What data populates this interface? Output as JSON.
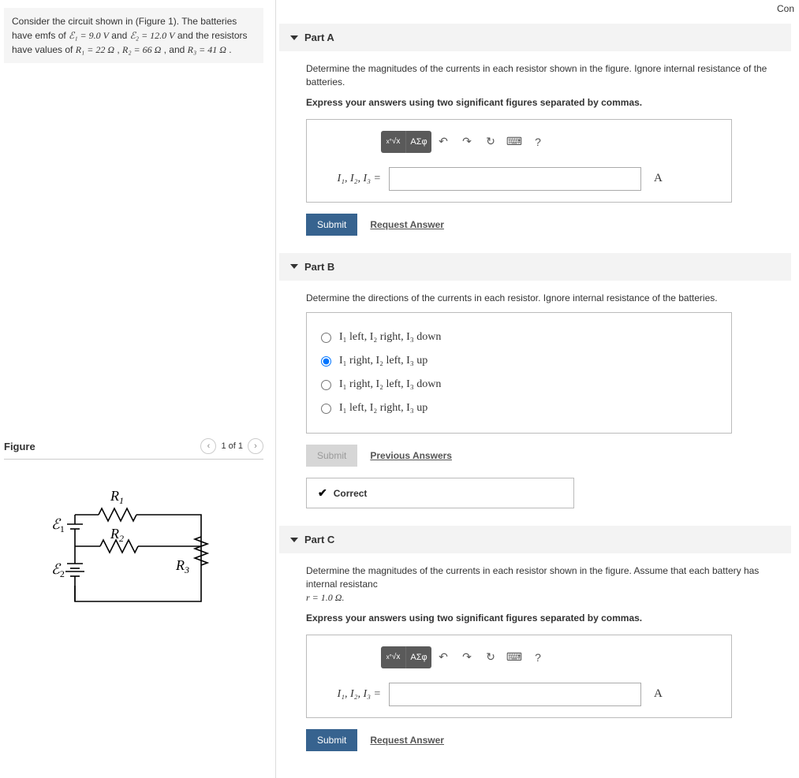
{
  "top_right": "Con",
  "problem": {
    "intro": "Consider the circuit shown in (Figure 1). The batteries have emfs of ",
    "e1": "ℰ₁ = 9.0 V",
    "and1": " and ",
    "e2": "ℰ₂ = 12.0 V",
    "and_resistors": " and the resistors have values of ",
    "r1": "R₁ = 22 Ω",
    "comma1": ", ",
    "r2": "R₂ = 66 Ω",
    "comma2": ", and ",
    "r3": "R₃ = 41 Ω",
    "period": "."
  },
  "figure": {
    "title": "Figure",
    "pager": "1 of 1",
    "labels": {
      "E1": "ℰ₁",
      "E2": "ℰ₂",
      "R1": "R₁",
      "R2": "R₂",
      "R3": "R₃"
    }
  },
  "partA": {
    "title": "Part A",
    "prompt": "Determine the magnitudes of the currents in each resistor shown in the figure. Ignore internal resistance of the batteries.",
    "instruction": "Express your answers using two significant figures separated by commas.",
    "input_label": "I₁, I₂, I₃ =",
    "unit": "A",
    "toolbar": {
      "templates": "√x",
      "symbols": "ΑΣφ",
      "undo": "↶",
      "redo": "↷",
      "reset": "↻",
      "keyboard": "⌨",
      "help": "?"
    },
    "submit": "Submit",
    "request": "Request Answer"
  },
  "partB": {
    "title": "Part B",
    "prompt": "Determine the directions of the currents in each resistor. Ignore internal resistance of the batteries.",
    "options": [
      "I₁ left, I₂ right, I₃ down",
      "I₁ right, I₂ left, I₃ up",
      "I₁ right, I₂ left, I₃ down",
      "I₁ left, I₂ right, I₃ up"
    ],
    "selected_index": 1,
    "submit": "Submit",
    "previous": "Previous Answers",
    "feedback": "Correct"
  },
  "partC": {
    "title": "Part C",
    "prompt_pre": "Determine the magnitudes of the currents in each resistor shown in the figure. Assume that each battery has internal resistanc",
    "prompt_r": "r = 1.0 Ω.",
    "instruction": "Express your answers using two significant figures separated by commas.",
    "input_label": "I₁, I₂, I₃ =",
    "unit": "A",
    "toolbar": {
      "templates": "√x",
      "symbols": "ΑΣφ",
      "undo": "↶",
      "redo": "↷",
      "reset": "↻",
      "keyboard": "⌨",
      "help": "?"
    },
    "submit": "Submit",
    "request": "Request Answer"
  }
}
